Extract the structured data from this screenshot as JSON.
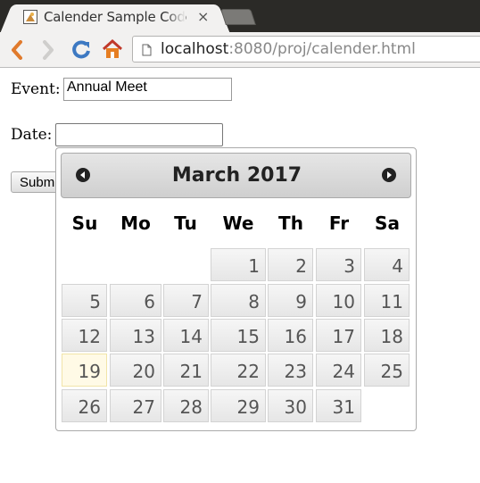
{
  "browser": {
    "tab_title": "Calender Sample Code",
    "tab_close": "×",
    "url_host": "localhost",
    "url_rest": ":8080/proj/calender.html"
  },
  "form": {
    "event_label": "Event:",
    "event_value": "Annual Meet",
    "date_label": "Date:",
    "date_value": "",
    "submit_label": "Submit"
  },
  "datepicker": {
    "month_title": "March 2017",
    "weekdays": [
      "Su",
      "Mo",
      "Tu",
      "We",
      "Th",
      "Fr",
      "Sa"
    ],
    "weeks": [
      [
        "",
        "",
        "",
        "1",
        "2",
        "3",
        "4"
      ],
      [
        "5",
        "6",
        "7",
        "8",
        "9",
        "10",
        "11"
      ],
      [
        "12",
        "13",
        "14",
        "15",
        "16",
        "17",
        "18"
      ],
      [
        "19",
        "20",
        "21",
        "22",
        "23",
        "24",
        "25"
      ],
      [
        "26",
        "27",
        "28",
        "29",
        "30",
        "31",
        ""
      ]
    ],
    "highlighted_day": "19"
  },
  "icons": {
    "back": "chevron-left-icon",
    "forward": "chevron-right-icon",
    "reload": "reload-icon",
    "home": "home-icon",
    "page": "page-icon",
    "prev_month": "prev-month-icon",
    "next_month": "next-month-icon"
  },
  "colors": {
    "back_arrow": "#e07a2c",
    "today_highlight": "#fffae6"
  }
}
